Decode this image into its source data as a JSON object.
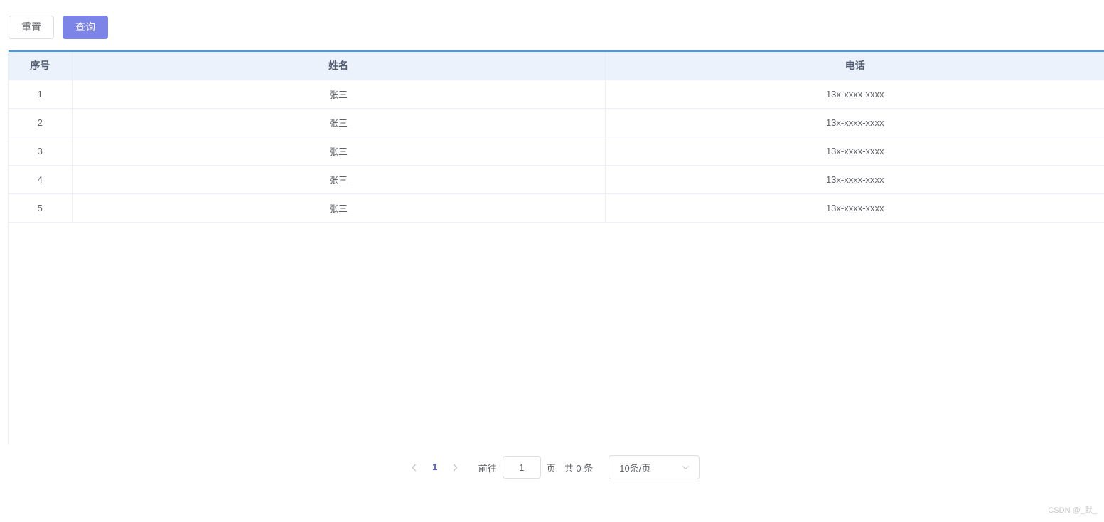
{
  "toolbar": {
    "reset_label": "重置",
    "query_label": "查询"
  },
  "table": {
    "columns": [
      {
        "key": "index",
        "label": "序号"
      },
      {
        "key": "name",
        "label": "姓名"
      },
      {
        "key": "phone",
        "label": "电话"
      }
    ],
    "rows": [
      {
        "index": "1",
        "name": "张三",
        "phone": "13x-xxxx-xxxx"
      },
      {
        "index": "2",
        "name": "张三",
        "phone": "13x-xxxx-xxxx"
      },
      {
        "index": "3",
        "name": "张三",
        "phone": "13x-xxxx-xxxx"
      },
      {
        "index": "4",
        "name": "张三",
        "phone": "13x-xxxx-xxxx"
      },
      {
        "index": "5",
        "name": "张三",
        "phone": "13x-xxxx-xxxx"
      }
    ]
  },
  "pagination": {
    "prev_icon": "chevron-left-icon",
    "next_icon": "chevron-right-icon",
    "current_page": "1",
    "jump_label": "前往",
    "jump_value": "1",
    "jump_placeholder": "",
    "page_unit_label": "页",
    "total_label": "共 0 条",
    "page_size_value": "10条/页",
    "page_size_chevron": "chevron-down-icon"
  },
  "watermark": {
    "text": "CSDN @_默_"
  },
  "colors": {
    "primary": "#7c84e8",
    "active_page": "#4b5ae0",
    "table_header_bg": "#ebf2fc",
    "table_top_border": "#409bf0",
    "border": "#ebeef5",
    "text": "#606266"
  }
}
